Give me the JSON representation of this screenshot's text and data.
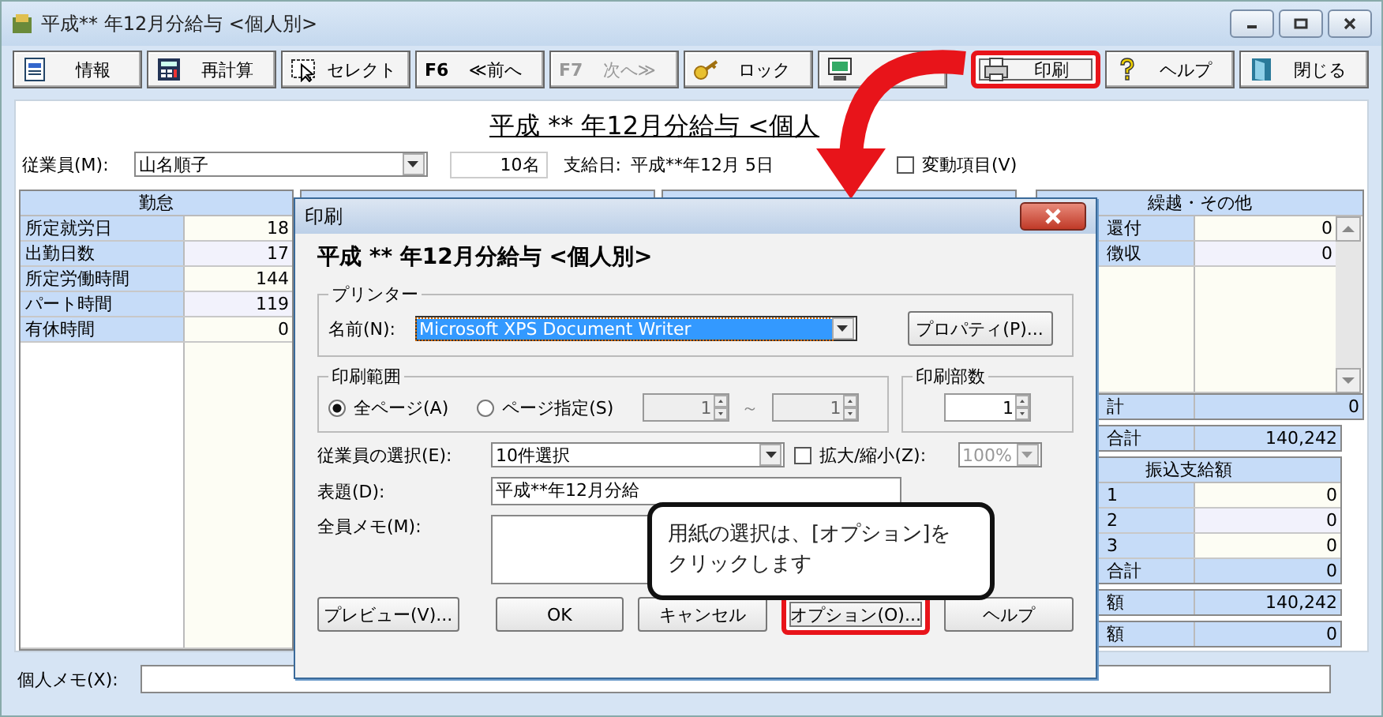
{
  "window": {
    "title": "平成** 年12月分給与 <個人別>"
  },
  "toolbar": [
    {
      "label": "情報",
      "highlighted": false,
      "disabled": false
    },
    {
      "label": "再計算",
      "highlighted": false,
      "disabled": false
    },
    {
      "label": "セレクト",
      "highlighted": false,
      "disabled": false
    },
    {
      "key": "F6",
      "label": "≪前へ",
      "highlighted": false,
      "disabled": false
    },
    {
      "key": "F7",
      "label": "次へ≫",
      "highlighted": false,
      "disabled": true
    },
    {
      "label": "ロック",
      "highlighted": false,
      "disabled": false
    },
    {
      "highlighted": false,
      "disabled": false
    },
    {
      "label": "印刷",
      "highlighted": true,
      "disabled": false
    },
    {
      "label": "ヘルプ",
      "highlighted": false,
      "disabled": false
    },
    {
      "label": "閉じる",
      "highlighted": false,
      "disabled": false
    }
  ],
  "page": {
    "title": "平成 ** 年12月分給与 <個人",
    "employee_label": "従業員(M):",
    "employee": "山名順子",
    "count": "10名",
    "payday_label": "支給日:",
    "payday": "平成**年12月 5日",
    "variable_items": {
      "label": "変動項目(V)",
      "checked": false
    }
  },
  "attendance": {
    "header": "勤怠",
    "rows": [
      {
        "label": "所定就労日",
        "value": "18"
      },
      {
        "label": "出勤日数",
        "value": "17"
      },
      {
        "label": "所定労働時間",
        "value": "144"
      },
      {
        "label": "パート時間",
        "value": "119"
      },
      {
        "label": "有休時間",
        "value": "0"
      }
    ]
  },
  "carry_over": {
    "header": "繰越・その他",
    "rows": [
      {
        "label": "還付",
        "value": "0"
      },
      {
        "label": "徴収",
        "value": "0"
      }
    ],
    "total": {
      "label": "計",
      "value": "0"
    }
  },
  "pay_total": {
    "label": "合計",
    "value": "140,242"
  },
  "transfer": {
    "header": "振込支給額",
    "rows": [
      {
        "label": "1",
        "value": "0"
      },
      {
        "label": "2",
        "value": "0"
      },
      {
        "label": "3",
        "value": "0"
      }
    ],
    "total": {
      "label": "合計",
      "value": "0"
    }
  },
  "net_rows": [
    {
      "label": "額",
      "value": "140,242"
    },
    {
      "label": "額",
      "value": "0"
    }
  ],
  "memo": {
    "label": "個人メモ(X):"
  },
  "dialog": {
    "title": "印刷",
    "heading": "平成 ** 年12月分給与 <個人別>",
    "printer": {
      "legend": "プリンター",
      "label": "名前(N):",
      "value": "Microsoft XPS Document Writer",
      "button": "プロパティ(P)..."
    },
    "range": {
      "legend": "印刷範囲",
      "options": [
        {
          "label": "全ページ(A)",
          "selected": true
        },
        {
          "label": "ページ指定(S)",
          "selected": false
        }
      ],
      "from": "1",
      "separator": "～",
      "to": "1"
    },
    "copies": {
      "legend": "印刷部数",
      "value": "1"
    },
    "employee_select": {
      "label": "従業員の選択(E):",
      "value": "10件選択"
    },
    "zoom": {
      "label": "拡大/縮小(Z):",
      "checked": false,
      "value": "100%"
    },
    "subject": {
      "label": "表題(D):",
      "value": "平成**年12月分給"
    },
    "all_memo": {
      "label": "全員メモ(M):"
    },
    "buttons": [
      {
        "label": "プレビュー(V)...",
        "highlighted": false
      },
      {
        "label": "OK",
        "highlighted": false
      },
      {
        "label": "キャンセル",
        "highlighted": false
      },
      {
        "label": "オプション(O)...",
        "highlighted": true
      },
      {
        "label": "ヘルプ",
        "highlighted": false
      }
    ]
  },
  "callout": {
    "lines": [
      "用紙の選択は、[オプション]を",
      "クリックします"
    ]
  }
}
